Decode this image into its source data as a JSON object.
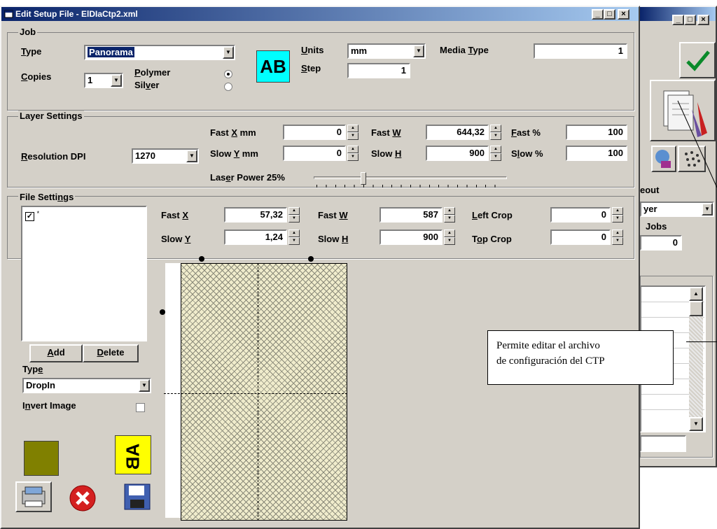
{
  "window": {
    "title": "Edit Setup File - ElDIaCtp2.xml",
    "min": "_",
    "max": "□",
    "close": "×"
  },
  "job": {
    "group": "Job",
    "type_label": "Type",
    "type_value": "Panorama",
    "copies_label": "Copies",
    "copies_value": "1",
    "polymer_label": "Polymer",
    "silver_label": "Silver",
    "ab_badge": "AB",
    "units_label": "Units",
    "units_value": "mm",
    "step_label": "Step",
    "step_value": "1",
    "media_type_label": "Media Type",
    "media_type_value": "1"
  },
  "layer": {
    "group": "Layer Settings",
    "resolution_label": "Resolution DPI",
    "resolution_value": "1270",
    "fastx_label": "Fast X mm",
    "fastx_value": "0",
    "slowy_label": "Slow Y mm",
    "slowy_value": "0",
    "fastw_label": "Fast W",
    "fastw_value": "644,32",
    "slowh_label": "Slow H",
    "slowh_value": "900",
    "fastpct_label": "Fast  %",
    "fastpct_value": "100",
    "slowpct_label": "Slow  %",
    "slowpct_value": "100",
    "laser_label": "Laser Power 25%",
    "laser_level": 0.25
  },
  "file": {
    "group": "File Settings",
    "list_item": "*",
    "fastx_label": "Fast X",
    "fastx_value": "57,32",
    "slowy_label": "Slow Y",
    "slowy_value": "1,24",
    "fastw_label": "Fast W",
    "fastw_value": "587",
    "slowh_label": "Slow H",
    "slowh_value": "900",
    "leftcrop_label": "Left Crop",
    "leftcrop_value": "0",
    "topcrop_label": "Top Crop",
    "topcrop_value": "0",
    "add_label": "Add",
    "delete_label": "Delete",
    "type_label": "Type",
    "type_value": "DropIn",
    "invert_label": "Invert Image",
    "ab_rot": "AB",
    "swatch_color": "#808000"
  },
  "back_window": {
    "min": "_",
    "max": "□",
    "close": "×",
    "label_out": "eout",
    "combo_val": "yer",
    "jobs_label": "Jobs",
    "jobs_value": "0"
  },
  "callout": {
    "line1": "Permite editar el archivo",
    "line2": "de configuración del CTP"
  }
}
